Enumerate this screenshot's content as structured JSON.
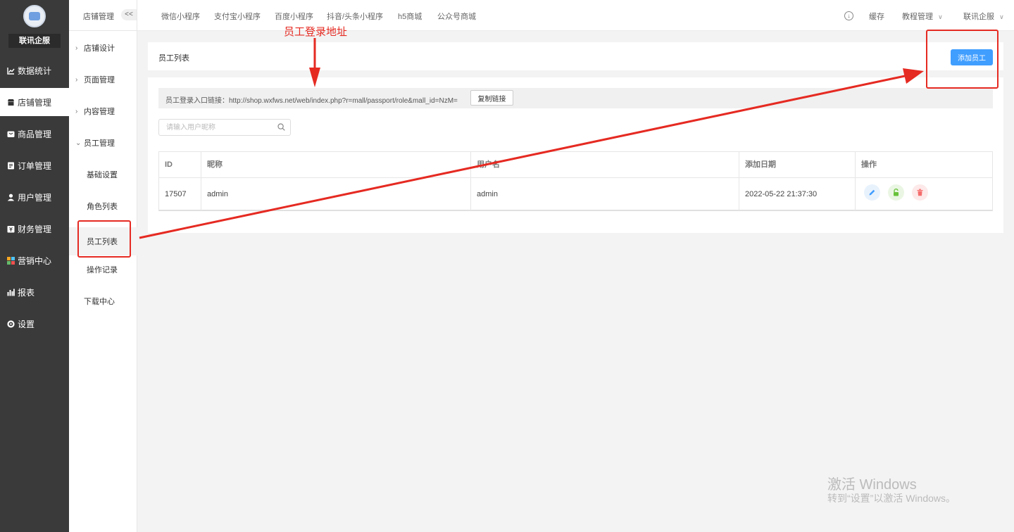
{
  "sidebar": {
    "brand": "联讯企服",
    "items": [
      {
        "label": "数据统计",
        "icon": "chart-line-icon"
      },
      {
        "label": "店铺管理",
        "icon": "store-icon"
      },
      {
        "label": "商品管理",
        "icon": "goods-icon"
      },
      {
        "label": "订单管理",
        "icon": "order-icon"
      },
      {
        "label": "用户管理",
        "icon": "user-icon"
      },
      {
        "label": "财务管理",
        "icon": "finance-icon"
      },
      {
        "label": "营销中心",
        "icon": "marketing-icon"
      },
      {
        "label": "报表",
        "icon": "report-icon"
      },
      {
        "label": "设置",
        "icon": "gear-icon"
      }
    ],
    "active_index": 1
  },
  "subnav": {
    "title": "店铺管理",
    "collapse_label": "<<",
    "groups": [
      "店铺设计",
      "页面管理",
      "内容管理",
      "员工管理"
    ],
    "children": [
      "基础设置",
      "角色列表",
      "员工列表",
      "操作记录"
    ],
    "download": "下载中心",
    "current_child": "员工列表"
  },
  "topbar": {
    "tabs": [
      "微信小程序",
      "支付宝小程序",
      "百度小程序",
      "抖音/头条小程序",
      "h5商城",
      "公众号商城"
    ],
    "cache": "缓存",
    "tutorial": "教程管理",
    "account": "联讯企服"
  },
  "page": {
    "title": "员工列表",
    "add_button": "添加员工",
    "login_link_label": "员工登录入口链接：",
    "login_link_url": "http://shop.wxfws.net/web/index.php?r=mall/passport/role&mall_id=NzM=",
    "copy_button": "复制链接",
    "search_placeholder": "请输入用户昵称"
  },
  "table": {
    "columns": [
      "ID",
      "昵称",
      "用户名",
      "添加日期",
      "操作"
    ],
    "rows": [
      {
        "id": "17507",
        "nickname": "admin",
        "username": "admin",
        "date": "2022-05-22 21:37:30"
      }
    ],
    "actions": [
      {
        "icon": "edit-icon",
        "color": "#409eff",
        "bg": "#e8f2fd"
      },
      {
        "icon": "unlock-icon",
        "color": "#67c23a",
        "bg": "#eaf6e3"
      },
      {
        "icon": "trash-icon",
        "color": "#f56c6c",
        "bg": "#fde9e9"
      }
    ]
  },
  "annotation": {
    "label": "员工登录地址",
    "color": "#e52a22"
  },
  "watermark": {
    "line1": "激活 Windows",
    "line2": "转到“设置”以激活 Windows。"
  }
}
